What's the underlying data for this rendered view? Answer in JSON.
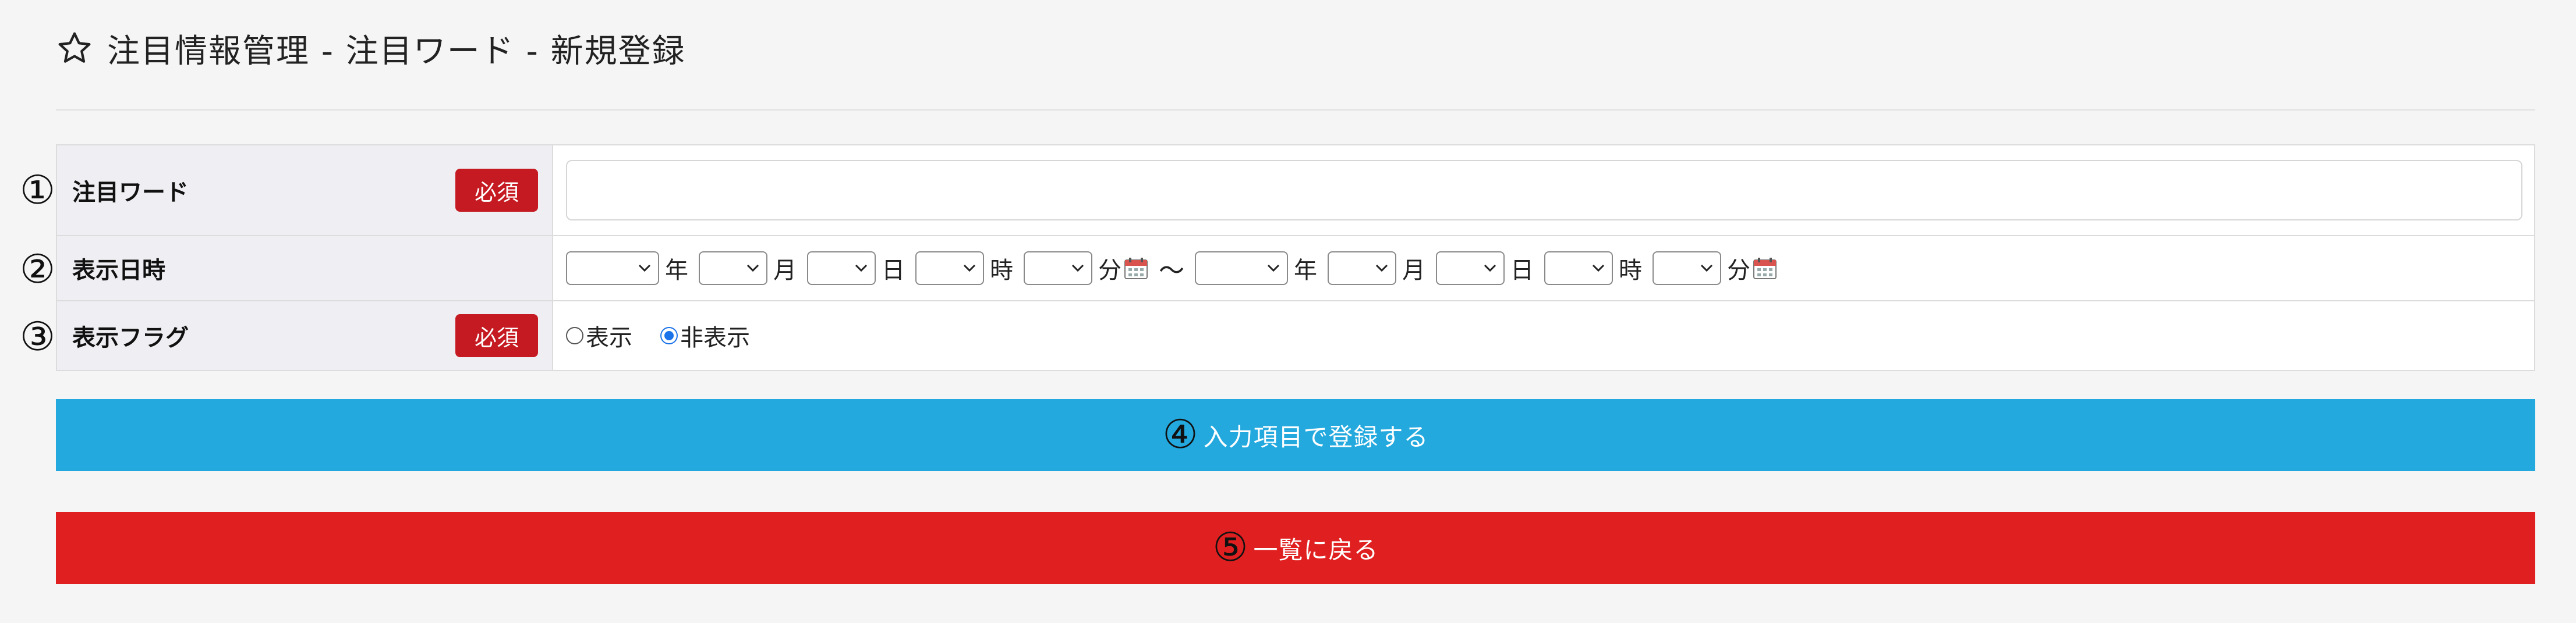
{
  "header": {
    "title": "注目情報管理 - 注目ワード - 新規登録"
  },
  "annotations": [
    "①",
    "②",
    "③",
    "④",
    "⑤"
  ],
  "form": {
    "required_label": "必須",
    "rows": [
      {
        "label": "注目ワード",
        "required": true,
        "input_value": ""
      },
      {
        "label": "表示日時",
        "required": false
      },
      {
        "label": "表示フラグ",
        "required": true
      }
    ],
    "datetime": {
      "unit_year": "年",
      "unit_month": "月",
      "unit_day": "日",
      "unit_hour": "時",
      "unit_minute": "分",
      "separator": "～"
    },
    "radio": {
      "options": [
        "表示",
        "非表示"
      ],
      "selected": "非表示"
    }
  },
  "buttons": {
    "register_label": "入力項目で登録する",
    "back_label": "一覧に戻る"
  },
  "colors": {
    "register": "#23a9de",
    "back": "#e02020",
    "required_badge": "#c51a21",
    "label_bg": "#efeff3"
  },
  "icons": [
    "star-outline-icon",
    "calendar-icon",
    "chevron-down-icon"
  ]
}
